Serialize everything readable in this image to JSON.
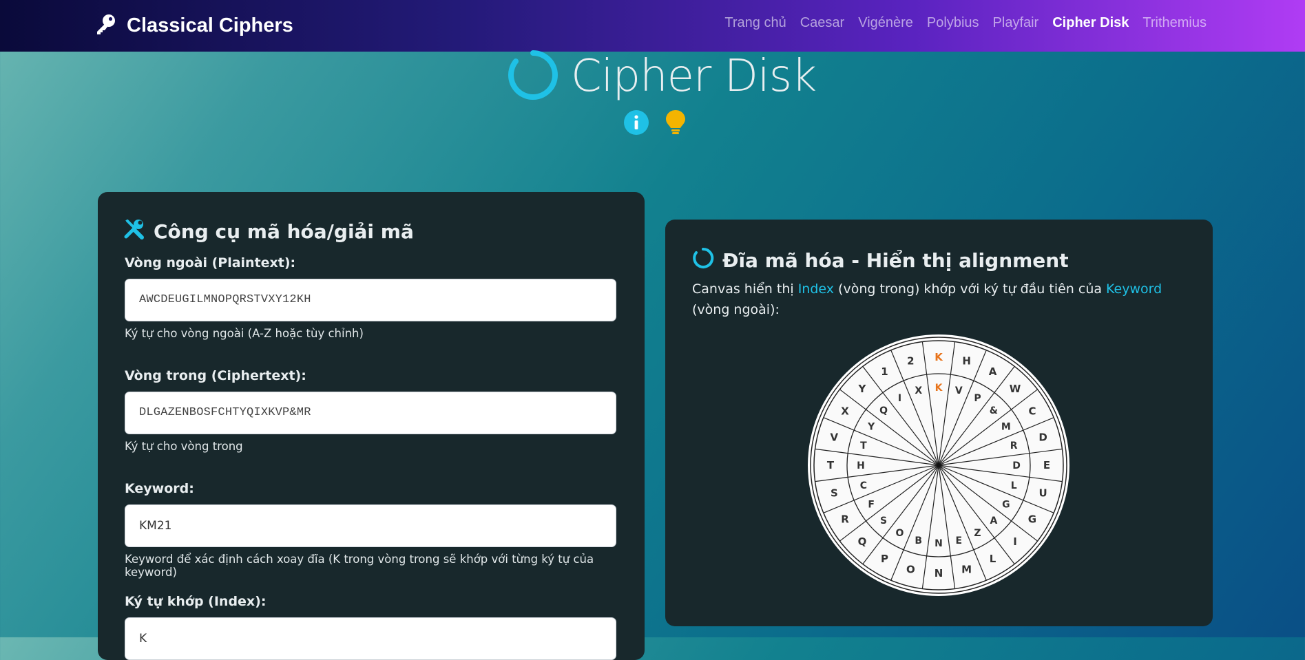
{
  "brand": {
    "name": "Classical Ciphers",
    "icon": "key-icon"
  },
  "nav": [
    {
      "label": "Trang chủ",
      "active": false
    },
    {
      "label": "Caesar",
      "active": false
    },
    {
      "label": "Vigénère",
      "active": false
    },
    {
      "label": "Polybius",
      "active": false
    },
    {
      "label": "Playfair",
      "active": false
    },
    {
      "label": "Cipher Disk",
      "active": true
    },
    {
      "label": "Trithemius",
      "active": false
    }
  ],
  "hero": {
    "title": "Cipher Disk",
    "icons": [
      "info-icon",
      "lightbulb-icon"
    ]
  },
  "tool": {
    "title": "Công cụ mã hóa/giải mã",
    "outer_label": "Vòng ngoài (Plaintext):",
    "outer_value": "AWCDEUGILMNOPQRSTVXY12KH",
    "outer_help": "Ký tự cho vòng ngoài (A-Z hoặc tùy chỉnh)",
    "inner_label": "Vòng trong (Ciphertext):",
    "inner_value": "DLGAZENBOSFCHTYQIXKVP&MR",
    "inner_help": "Ký tự cho vòng trong",
    "keyword_label": "Keyword:",
    "keyword_value": "KM21",
    "keyword_help": "Keyword để xác định cách xoay đĩa (K trong vòng trong sẽ khớp với từng ký tự của keyword)",
    "index_label": "Ký tự khớp (Index):",
    "index_value": "K"
  },
  "disk_panel": {
    "title": "Đĩa mã hóa - Hiển thị alignment",
    "desc_1": "Canvas hiển thị ",
    "desc_index": "Index",
    "desc_2": " (vòng trong) khớp với ký tự đầu tiên của ",
    "desc_keyword": "Keyword",
    "desc_3": " (vòng ngoài):",
    "outer_ring": [
      "K",
      "H",
      "A",
      "W",
      "C",
      "D",
      "E",
      "U",
      "G",
      "I",
      "L",
      "M",
      "N",
      "O",
      "P",
      "Q",
      "R",
      "S",
      "T",
      "V",
      "X",
      "Y",
      "1",
      "2"
    ],
    "inner_ring": [
      "K",
      "V",
      "P",
      "&",
      "M",
      "R",
      "D",
      "L",
      "G",
      "A",
      "Z",
      "E",
      "N",
      "B",
      "O",
      "S",
      "F",
      "C",
      "H",
      "T",
      "Y",
      "Q",
      "I",
      "X"
    ],
    "highlight": "K",
    "colors": {
      "highlight": "#e8741c",
      "accent": "#1fc1e6",
      "bulb": "#f4b400"
    }
  }
}
